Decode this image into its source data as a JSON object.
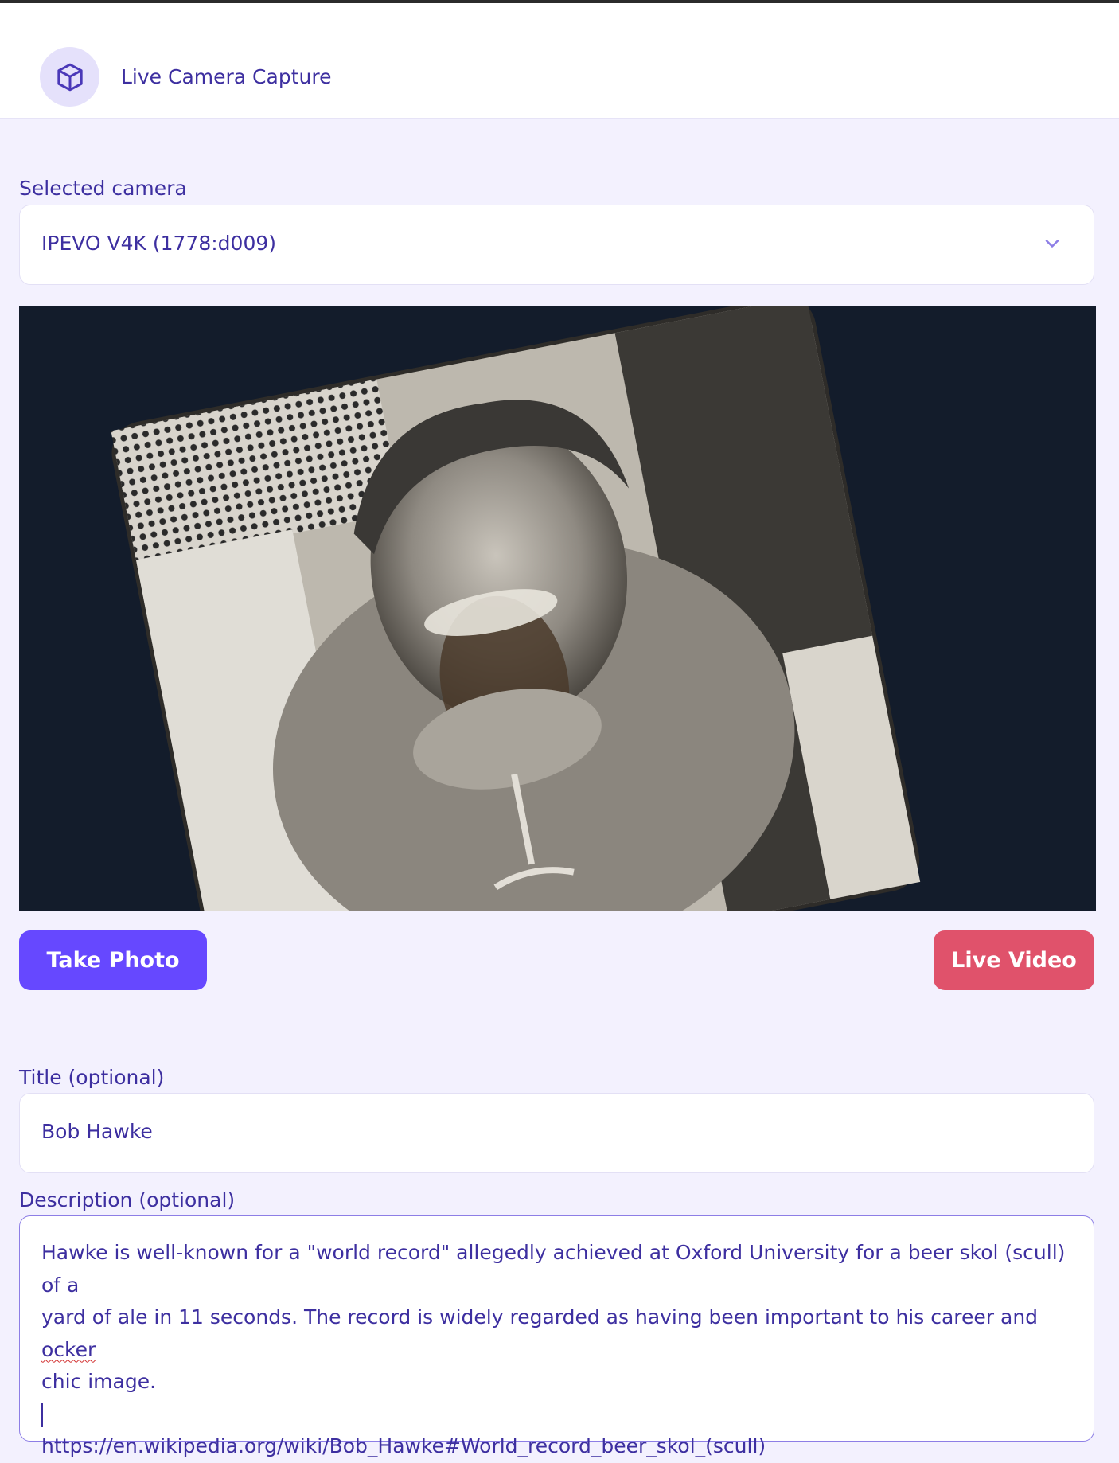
{
  "header": {
    "title": "Live Camera Capture",
    "icon": "cube-icon"
  },
  "camera_select": {
    "label": "Selected camera",
    "value": "IPEVO V4K (1778:d009)",
    "icon": "chevron-down-icon"
  },
  "preview": {
    "kind": "live camera preview of a black-and-white printed photo of a man drinking beer from a glass"
  },
  "buttons": {
    "take_photo": "Take Photo",
    "live_video": "Live Video"
  },
  "title_field": {
    "label": "Title (optional)",
    "value": "Bob Hawke"
  },
  "description_field": {
    "label": "Description (optional)",
    "line1": "Hawke is well-known for a \"world record\" allegedly achieved at Oxford University for a beer skol (scull) of a",
    "line2_before": "yard of ale in 11 seconds. The record is widely regarded as having been important to his career and ",
    "line2_misspelled": "ocker",
    "line3": "chic image.",
    "link": "https://en.wikipedia.org/wiki/Bob_Hawke#World_record_beer_skol_(scull)"
  },
  "colors": {
    "accent": "#6648ff",
    "danger": "#e0526b",
    "text": "#3d2fa0",
    "background": "#f3f1fe"
  }
}
